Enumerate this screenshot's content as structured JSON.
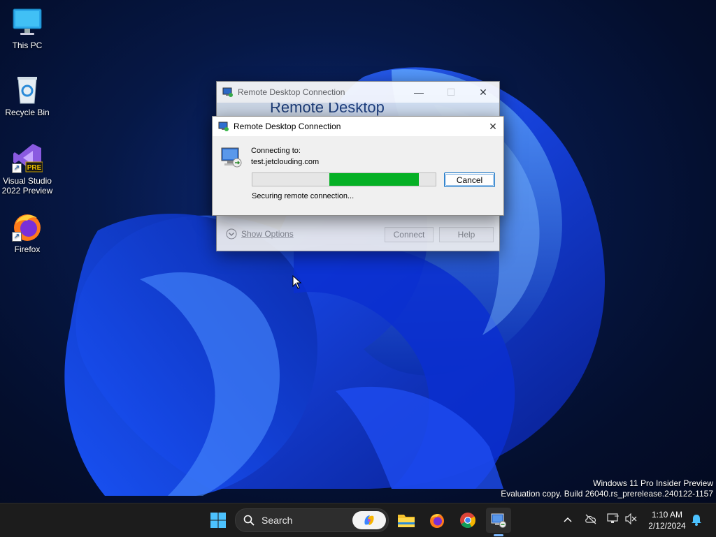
{
  "desktop": {
    "icons": [
      {
        "label": "This PC"
      },
      {
        "label": "Recycle Bin"
      },
      {
        "label": "Visual Studio 2022 Preview",
        "badge": "PRE"
      },
      {
        "label": "Firefox"
      }
    ],
    "watermark": {
      "line1": "Windows 11 Pro Insider Preview",
      "line2": "Evaluation copy. Build 26040.rs_prerelease.240122-1157"
    }
  },
  "back_window": {
    "title": "Remote Desktop Connection",
    "banner": "Remote Desktop",
    "show_options": "Show Options",
    "connect": "Connect",
    "help": "Help"
  },
  "dialog": {
    "title": "Remote Desktop Connection",
    "connecting_label": "Connecting to:",
    "host": "test.jetclouding.com",
    "status": "Securing remote connection...",
    "cancel": "Cancel",
    "progress": {
      "start_fraction": 0.42,
      "end_fraction": 0.91,
      "color": "#06b025"
    }
  },
  "taskbar": {
    "search_placeholder": "Search",
    "time": "1:10 AM",
    "date": "2/12/2024",
    "apps": [
      "start-icon",
      "search-icon",
      "copilot-icon",
      "file-explorer-icon",
      "firefox-icon",
      "chrome-icon",
      "remote-desktop-icon"
    ]
  },
  "colors": {
    "accent": "#0067c0",
    "progress": "#06b025",
    "taskbar": "#1c1c1c"
  }
}
